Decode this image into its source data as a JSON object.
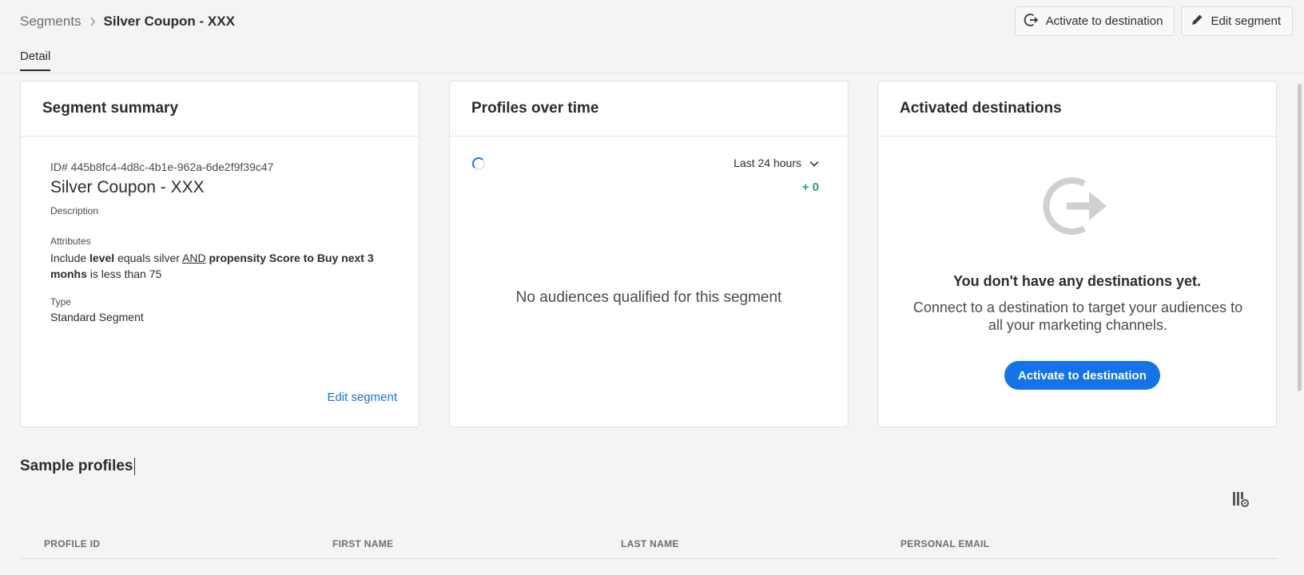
{
  "breadcrumb": {
    "parent": "Segments",
    "current": "Silver Coupon - XXX"
  },
  "toolbar": {
    "activate_label": "Activate to destination",
    "edit_label": "Edit segment"
  },
  "tabs": [
    {
      "label": "Detail"
    }
  ],
  "summary": {
    "title": "Segment summary",
    "id_text": "ID# 445b8fc4-4d8c-4b1e-962a-6de2f9f39c47",
    "name": "Silver Coupon - XXX",
    "description_label": "Description",
    "attributes_label": "Attributes",
    "attr": {
      "include": "Include ",
      "level": "level",
      "equals": " equals silver ",
      "and": "AND",
      "propensity": " propensity Score to Buy next 3 monhs",
      "less": " is less than 75"
    },
    "type_label": "Type",
    "type_value": "Standard Segment",
    "edit_link": "Edit segment"
  },
  "profiles": {
    "title": "Profiles over time",
    "range": "Last 24 hours",
    "delta": "+ 0",
    "empty_message": "No audiences qualified for this segment"
  },
  "destinations": {
    "title": "Activated destinations",
    "empty_title": "You don't have any destinations yet.",
    "empty_desc": "Connect to a destination to target your audiences to all your marketing channels.",
    "cta": "Activate to destination"
  },
  "sample": {
    "title": "Sample profiles",
    "columns": [
      "PROFILE ID",
      "FIRST NAME",
      "LAST NAME",
      "PERSONAL EMAIL"
    ]
  },
  "colors": {
    "accent": "#1473e6",
    "positive": "#2d9d78",
    "background": "#f4f4f4"
  },
  "icons": [
    "chevron-right-icon",
    "export-icon",
    "pencil-icon",
    "spinner-icon",
    "chevron-down-icon",
    "column-settings-icon"
  ]
}
